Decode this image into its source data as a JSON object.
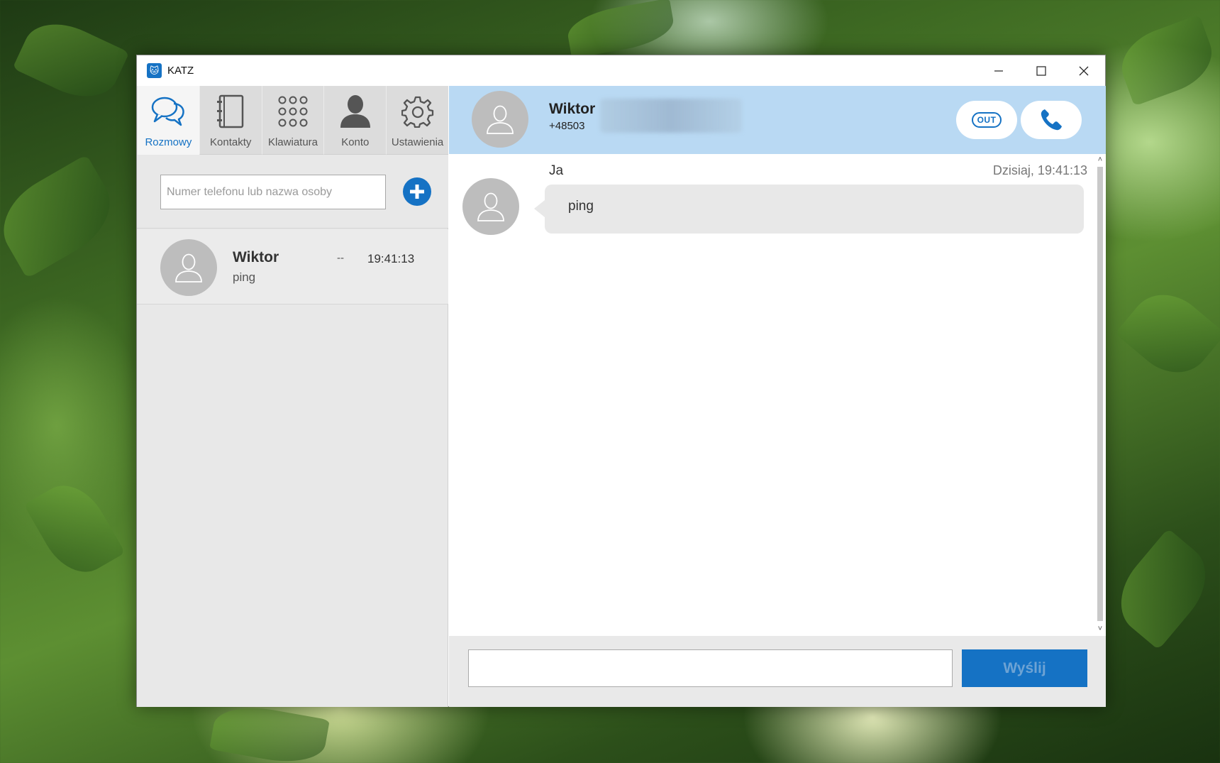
{
  "window": {
    "title": "KATZ",
    "minimize_icon": "minimize-icon",
    "maximize_icon": "maximize-icon",
    "close_icon": "close-icon"
  },
  "nav": {
    "tabs": [
      {
        "label": "Rozmowy",
        "icon": "chat-bubbles-icon",
        "active": true
      },
      {
        "label": "Kontakty",
        "icon": "address-book-icon",
        "active": false
      },
      {
        "label": "Klawiatura",
        "icon": "keypad-icon",
        "active": false
      },
      {
        "label": "Konto",
        "icon": "person-icon",
        "active": false
      },
      {
        "label": "Ustawienia",
        "icon": "gear-icon",
        "active": false
      }
    ]
  },
  "search": {
    "placeholder": "Numer telefonu lub nazwa osoby",
    "value": ""
  },
  "conversations": [
    {
      "name": "Wiktor",
      "preview": "ping",
      "status": "--",
      "time": "19:41:13"
    }
  ],
  "chat_header": {
    "name": "Wiktor",
    "number": "+48503",
    "out_label": "OUT"
  },
  "messages": [
    {
      "sender": "Ja",
      "time": "Dzisiaj, 19:41:13",
      "text": "ping"
    }
  ],
  "composer": {
    "value": "",
    "send_label": "Wyślij"
  },
  "colors": {
    "accent": "#1572c4",
    "header_bg": "#b9d9f3",
    "panel_bg": "#e8e8e8"
  }
}
